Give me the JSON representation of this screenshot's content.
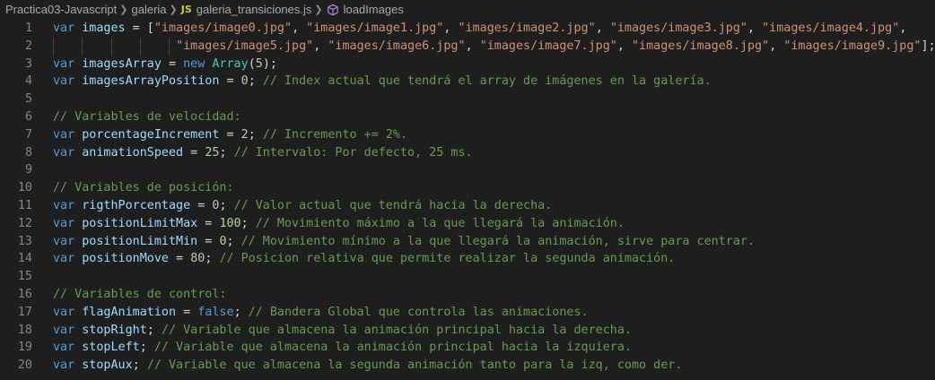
{
  "breadcrumb": {
    "folder": "Practica03-Javascript",
    "subfolder": "galeria",
    "file_badge": "JS",
    "file": "galeria_transiciones.js",
    "symbol": "loadImages"
  },
  "lines": [
    {
      "n": "1",
      "t": [
        [
          "kw",
          "var "
        ],
        [
          "var",
          "images"
        ],
        [
          "op",
          " = ["
        ],
        [
          "str",
          "\"images/image0.jpg\""
        ],
        [
          "op",
          ", "
        ],
        [
          "str",
          "\"images/image1.jpg\""
        ],
        [
          "op",
          ", "
        ],
        [
          "str",
          "\"images/image2.jpg\""
        ],
        [
          "op",
          ", "
        ],
        [
          "str",
          "\"images/image3.jpg\""
        ],
        [
          "op",
          ", "
        ],
        [
          "str",
          "\"images/image4.jpg\""
        ],
        [
          "op",
          ","
        ]
      ]
    },
    {
      "n": "2",
      "t": [
        [
          "op",
          "                 "
        ],
        [
          "str",
          "\"images/image5.jpg\""
        ],
        [
          "op",
          ", "
        ],
        [
          "str",
          "\"images/image6.jpg\""
        ],
        [
          "op",
          ", "
        ],
        [
          "str",
          "\"images/image7.jpg\""
        ],
        [
          "op",
          ", "
        ],
        [
          "str",
          "\"images/image8.jpg\""
        ],
        [
          "op",
          ", "
        ],
        [
          "str",
          "\"images/image9.jpg\""
        ],
        [
          "op",
          "];"
        ]
      ]
    },
    {
      "n": "3",
      "t": [
        [
          "kw",
          "var "
        ],
        [
          "var",
          "imagesArray"
        ],
        [
          "op",
          " = "
        ],
        [
          "kw",
          "new "
        ],
        [
          "cls",
          "Array"
        ],
        [
          "op",
          "("
        ],
        [
          "num",
          "5"
        ],
        [
          "op",
          ");"
        ]
      ]
    },
    {
      "n": "4",
      "t": [
        [
          "kw",
          "var "
        ],
        [
          "var",
          "imagesArrayPosition"
        ],
        [
          "op",
          " = "
        ],
        [
          "num",
          "0"
        ],
        [
          "op",
          "; "
        ],
        [
          "cmt",
          "// Index actual que tendrá el array de imágenes en la galería."
        ]
      ]
    },
    {
      "n": "5",
      "t": []
    },
    {
      "n": "6",
      "t": [
        [
          "cmt",
          "// Variables de velocidad:"
        ]
      ]
    },
    {
      "n": "7",
      "t": [
        [
          "kw",
          "var "
        ],
        [
          "var",
          "porcentageIncrement"
        ],
        [
          "op",
          " = "
        ],
        [
          "num",
          "2"
        ],
        [
          "op",
          "; "
        ],
        [
          "cmt",
          "// Incremento += 2%."
        ]
      ]
    },
    {
      "n": "8",
      "t": [
        [
          "kw",
          "var "
        ],
        [
          "var",
          "animationSpeed"
        ],
        [
          "op",
          " = "
        ],
        [
          "num",
          "25"
        ],
        [
          "op",
          "; "
        ],
        [
          "cmt",
          "// Intervalo: Por defecto, 25 ms."
        ]
      ]
    },
    {
      "n": "9",
      "t": []
    },
    {
      "n": "10",
      "t": [
        [
          "cmt",
          "// Variables de posición:"
        ]
      ]
    },
    {
      "n": "11",
      "t": [
        [
          "kw",
          "var "
        ],
        [
          "var",
          "rigthPorcentage"
        ],
        [
          "op",
          " = "
        ],
        [
          "num",
          "0"
        ],
        [
          "op",
          "; "
        ],
        [
          "cmt",
          "// Valor actual que tendrá hacia la derecha."
        ]
      ]
    },
    {
      "n": "12",
      "t": [
        [
          "kw",
          "var "
        ],
        [
          "var",
          "positionLimitMax"
        ],
        [
          "op",
          " = "
        ],
        [
          "num",
          "100"
        ],
        [
          "op",
          "; "
        ],
        [
          "cmt",
          "// Movimiento máximo a la que llegará la animación."
        ]
      ]
    },
    {
      "n": "13",
      "t": [
        [
          "kw",
          "var "
        ],
        [
          "var",
          "positionLimitMin"
        ],
        [
          "op",
          " = "
        ],
        [
          "num",
          "0"
        ],
        [
          "op",
          "; "
        ],
        [
          "cmt",
          "// Movimiento mínimo a la que llegará la animación, sirve para centrar."
        ]
      ]
    },
    {
      "n": "14",
      "t": [
        [
          "kw",
          "var "
        ],
        [
          "var",
          "positionMove"
        ],
        [
          "op",
          " = "
        ],
        [
          "num",
          "80"
        ],
        [
          "op",
          "; "
        ],
        [
          "cmt",
          "// Posicion relativa que permite realizar la segunda animación."
        ]
      ]
    },
    {
      "n": "15",
      "t": []
    },
    {
      "n": "16",
      "t": [
        [
          "cmt",
          "// Variables de control:"
        ]
      ]
    },
    {
      "n": "17",
      "t": [
        [
          "kw",
          "var "
        ],
        [
          "var",
          "flagAnimation"
        ],
        [
          "op",
          " = "
        ],
        [
          "kw",
          "false"
        ],
        [
          "op",
          "; "
        ],
        [
          "cmt",
          "// Bandera Global que controla las animaciones."
        ]
      ]
    },
    {
      "n": "18",
      "t": [
        [
          "kw",
          "var "
        ],
        [
          "var",
          "stopRight"
        ],
        [
          "op",
          "; "
        ],
        [
          "cmt",
          "// Variable que almacena la animación principal hacia la derecha."
        ]
      ]
    },
    {
      "n": "19",
      "t": [
        [
          "kw",
          "var "
        ],
        [
          "var",
          "stopLeft"
        ],
        [
          "op",
          "; "
        ],
        [
          "cmt",
          "// Variable que almacena la animación principal hacia la izquiera."
        ]
      ]
    },
    {
      "n": "20",
      "t": [
        [
          "kw",
          "var "
        ],
        [
          "var",
          "stopAux"
        ],
        [
          "op",
          "; "
        ],
        [
          "cmt",
          "// Variable que almacena la segunda animación tanto para la izq, como der."
        ]
      ]
    }
  ]
}
